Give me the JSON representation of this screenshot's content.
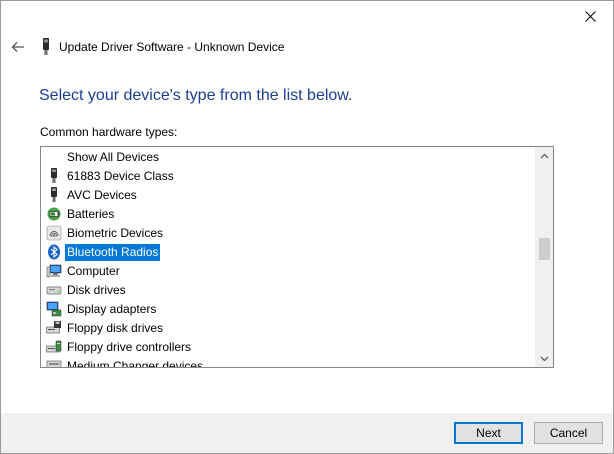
{
  "window": {
    "title": "Update Driver Software - Unknown Device",
    "heading": "Select your device's type from the list below.",
    "list_label": "Common hardware types:"
  },
  "list": {
    "items": [
      {
        "label": "Show All Devices",
        "icon": "none-icon"
      },
      {
        "label": "61883 Device Class",
        "icon": "device-plug-icon"
      },
      {
        "label": "AVC Devices",
        "icon": "device-plug-icon"
      },
      {
        "label": "Batteries",
        "icon": "battery-icon"
      },
      {
        "label": "Biometric Devices",
        "icon": "fingerprint-icon"
      },
      {
        "label": "Bluetooth Radios",
        "icon": "bluetooth-icon",
        "selected": true
      },
      {
        "label": "Computer",
        "icon": "computer-icon"
      },
      {
        "label": "Disk drives",
        "icon": "disk-drive-icon"
      },
      {
        "label": "Display adapters",
        "icon": "display-adapter-icon"
      },
      {
        "label": "Floppy disk drives",
        "icon": "floppy-drive-icon"
      },
      {
        "label": "Floppy drive controllers",
        "icon": "floppy-controller-icon"
      },
      {
        "label": "Medium Changer devices",
        "icon": "medium-changer-icon"
      }
    ]
  },
  "buttons": {
    "next": "Next",
    "cancel": "Cancel"
  },
  "colors": {
    "heading": "#1a3e96",
    "selection": "#0078d7",
    "footer": "#f0f0f0"
  }
}
